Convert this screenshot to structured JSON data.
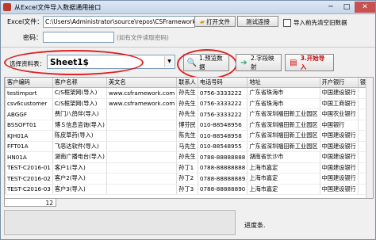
{
  "window": {
    "title": "从Excel文件导入数据通用接口",
    "min": "─",
    "max": "□",
    "close": "✕"
  },
  "file": {
    "label": "Excel文件：",
    "path": "C:\\Users\\Administrator\\source\\repos\\CSFramework.GenericImp",
    "open_button": "打开文件",
    "test_button": "测试连接",
    "clear_checkbox": "导入前先清空旧数据"
  },
  "password": {
    "label": "密码：",
    "hint": "(如有文件读取密码)"
  },
  "sheet": {
    "label": "选择资料表：",
    "value": "Sheet1$"
  },
  "toolbar": {
    "preview_button": "1.预览数据",
    "mapping_button": "2.字段映射",
    "import_button": "3.开始导入",
    "preview_icon": "magnifier-document-icon",
    "mapping_icon": "arrow-right-icon",
    "import_icon": "import-document-icon"
  },
  "colors": {
    "annotation_red": "#d22222",
    "import_label": "#cc0000"
  },
  "table": {
    "columns": [
      "客户编码",
      "客户名称",
      "英文名",
      "联系人",
      "电话号码",
      "地址",
      "开户银行",
      "银行"
    ],
    "rows": [
      [
        "testimport",
        "C/S框架网(导入)",
        "www.csframework.com",
        "孙先生",
        "0756-3333222",
        "广东省珠海市",
        "中国建设银行",
        ""
      ],
      [
        "csv6customer",
        "C/S框架网(导入)",
        "www.csframework.com",
        "孙先生",
        "0756-3333222",
        "广东省珠海市",
        "中国工商银行",
        ""
      ],
      [
        "ABGGF",
        "费门八鸽伴(导入)",
        "",
        "孙先生",
        "0756-3333222",
        "广东省深圳福田新工业园区",
        "中国农业银行",
        ""
      ],
      [
        "BSSOFT01",
        "博Ｓ信息咨询(导入)",
        "",
        "博芬民",
        "010-88548956",
        "广东省深圳福田新工业园区",
        "中国银行",
        ""
      ],
      [
        "KJH01A",
        "陈皮草药(导入)",
        "",
        "陈先生",
        "010-88548958",
        "广东省深圳福田新工业园区",
        "中国建设银行",
        ""
      ],
      [
        "FFT01A",
        "飞恶达软件(导入)",
        "",
        "马先生",
        "010-88548955",
        "广东省深圳福田新工业园区",
        "中国建设银行",
        ""
      ],
      [
        "HN01A",
        "湖南广播电台(导入)",
        "",
        "孙先生",
        "0788-88888888",
        "湖南省长沙市",
        "中国建设银行",
        ""
      ],
      [
        "TEST-C2016-01",
        "客户1(导入)",
        "",
        "孙丁1",
        "0788-88888888",
        "上海市嘉定",
        "中国建设银行",
        ""
      ],
      [
        "TEST-C2016-02",
        "客户2(导入)",
        "",
        "孙丁2",
        "0788-88888889",
        "上海市嘉定",
        "中国建设银行",
        ""
      ],
      [
        "TEST-C2016-03",
        "客户3(导入)",
        "",
        "孙丁3",
        "0788-88888890",
        "上海市嘉定",
        "中国建设银行",
        ""
      ]
    ],
    "row_count": "12"
  },
  "status": {
    "label": "进度条."
  }
}
